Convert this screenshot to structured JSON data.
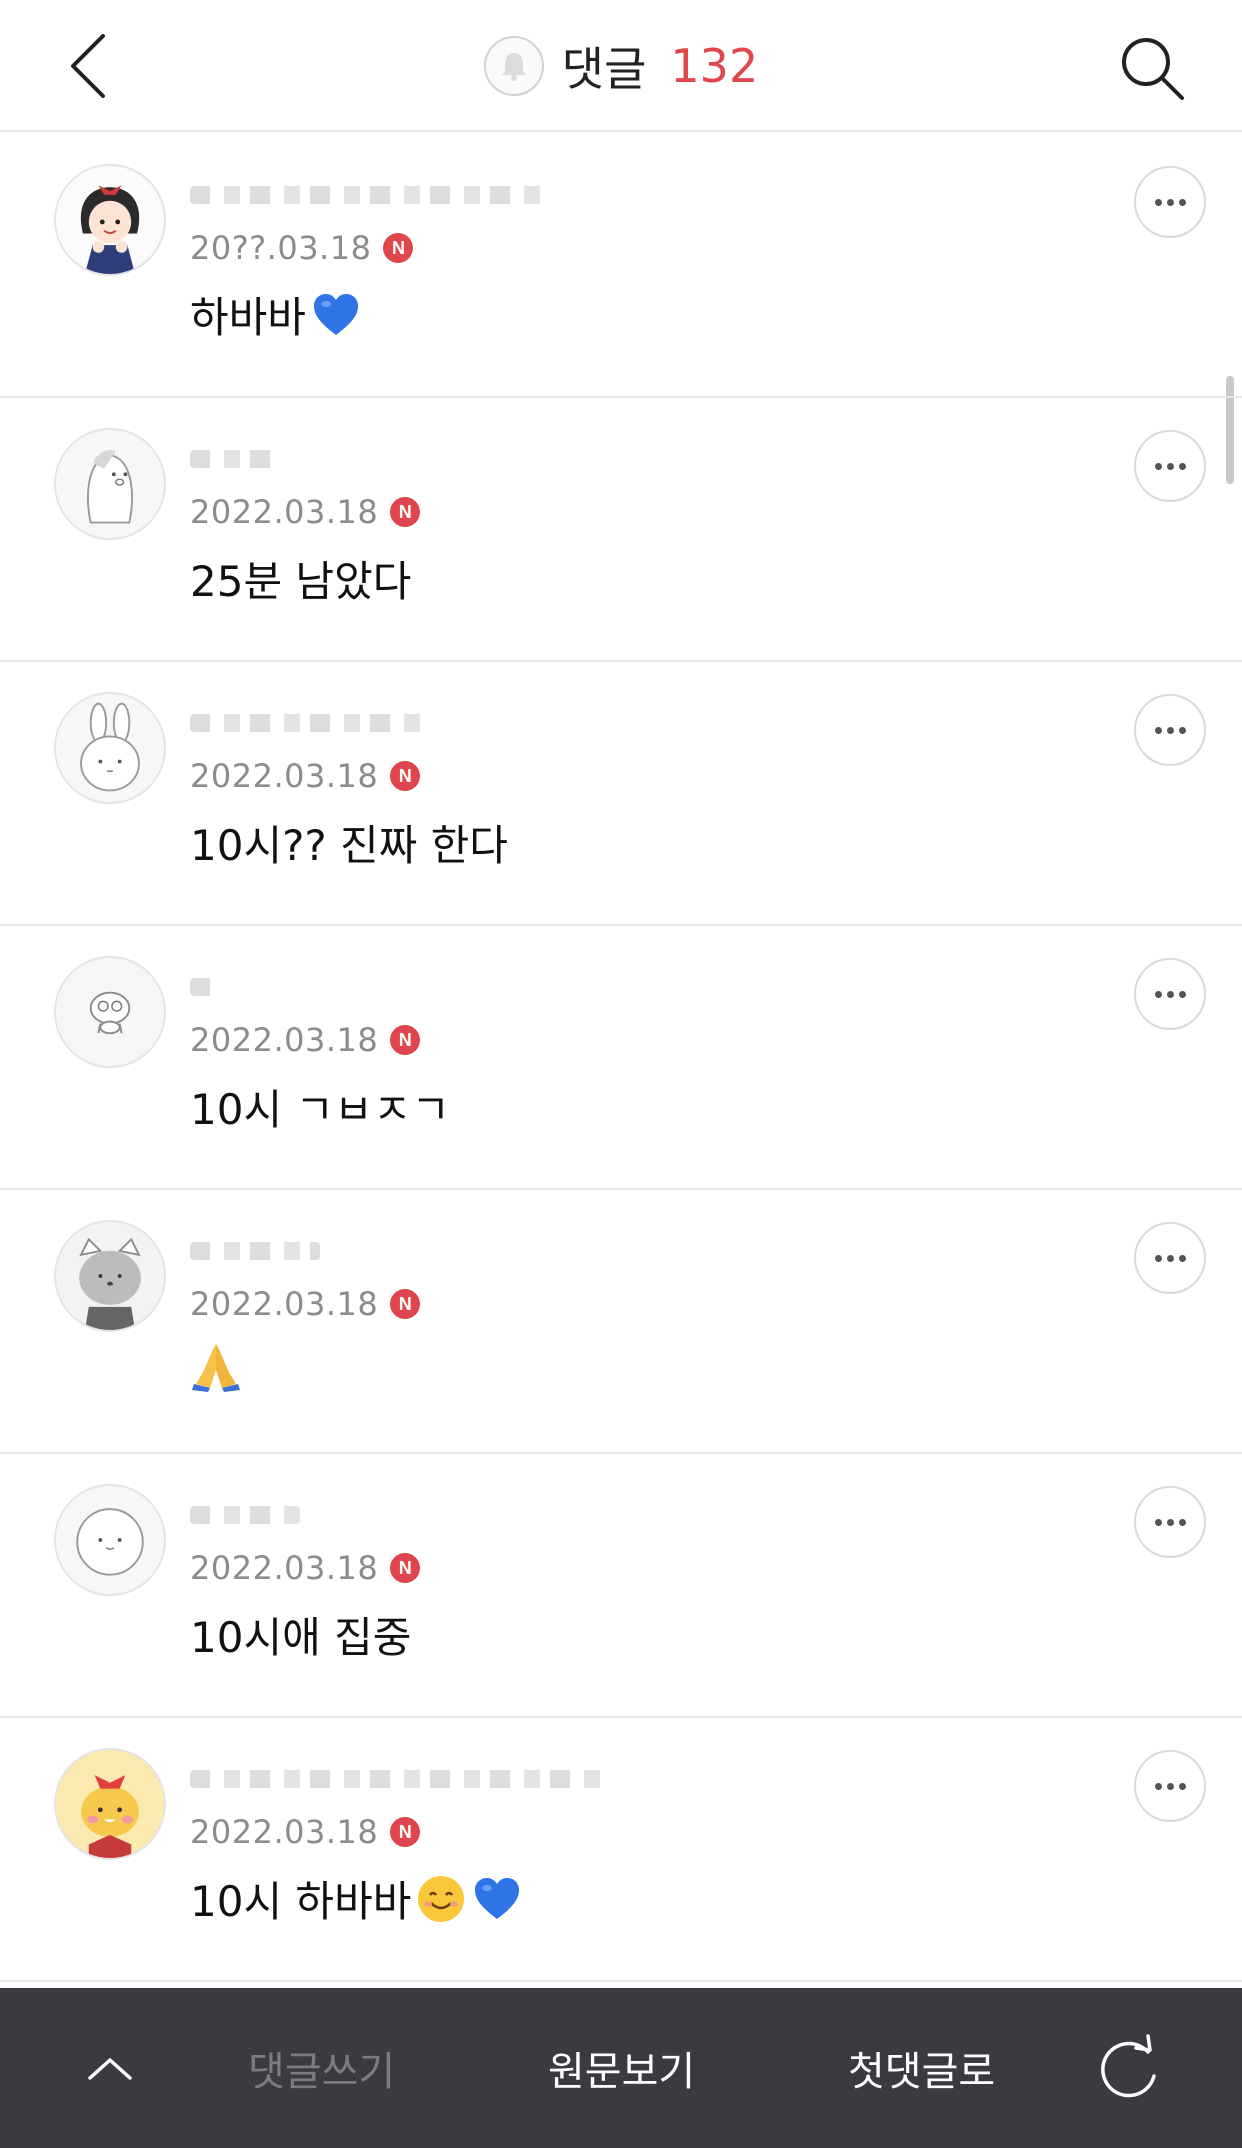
{
  "header": {
    "title": "댓글",
    "count": "132",
    "icons": {
      "back": "chevron-left-icon",
      "bell": "bell-icon",
      "search": "search-icon"
    }
  },
  "comments": [
    {
      "date": "20??.03.18",
      "badge": "N",
      "text": "하바바",
      "emoji": "blue-heart"
    },
    {
      "date": "2022.03.18",
      "badge": "N",
      "text": "25분 남았다",
      "emoji": ""
    },
    {
      "date": "2022.03.18",
      "badge": "N",
      "text": "10시?? 진짜 한다",
      "emoji": ""
    },
    {
      "date": "2022.03.18",
      "badge": "N",
      "text": "10시 ㄱㅂㅈㄱ",
      "emoji": ""
    },
    {
      "date": "2022.03.18",
      "badge": "N",
      "text": "",
      "emoji": "folded-hands"
    },
    {
      "date": "2022.03.18",
      "badge": "N",
      "text": "10시애 집중",
      "emoji": ""
    },
    {
      "date": "2022.03.18",
      "badge": "N",
      "text": "10시 하바바",
      "emoji": "smile-and-blue-heart"
    }
  ],
  "bottom_bar": {
    "write_label": "댓글쓰기",
    "original_label": "원문보기",
    "first_label": "첫댓글로",
    "icons": {
      "up": "chevron-up-icon",
      "refresh": "refresh-icon"
    }
  },
  "colors": {
    "accent_red": "#e0474c",
    "bottom_bar_bg": "#3a3b40",
    "date_gray": "#8c8c8c",
    "disabled_label": "#7b7c81"
  }
}
